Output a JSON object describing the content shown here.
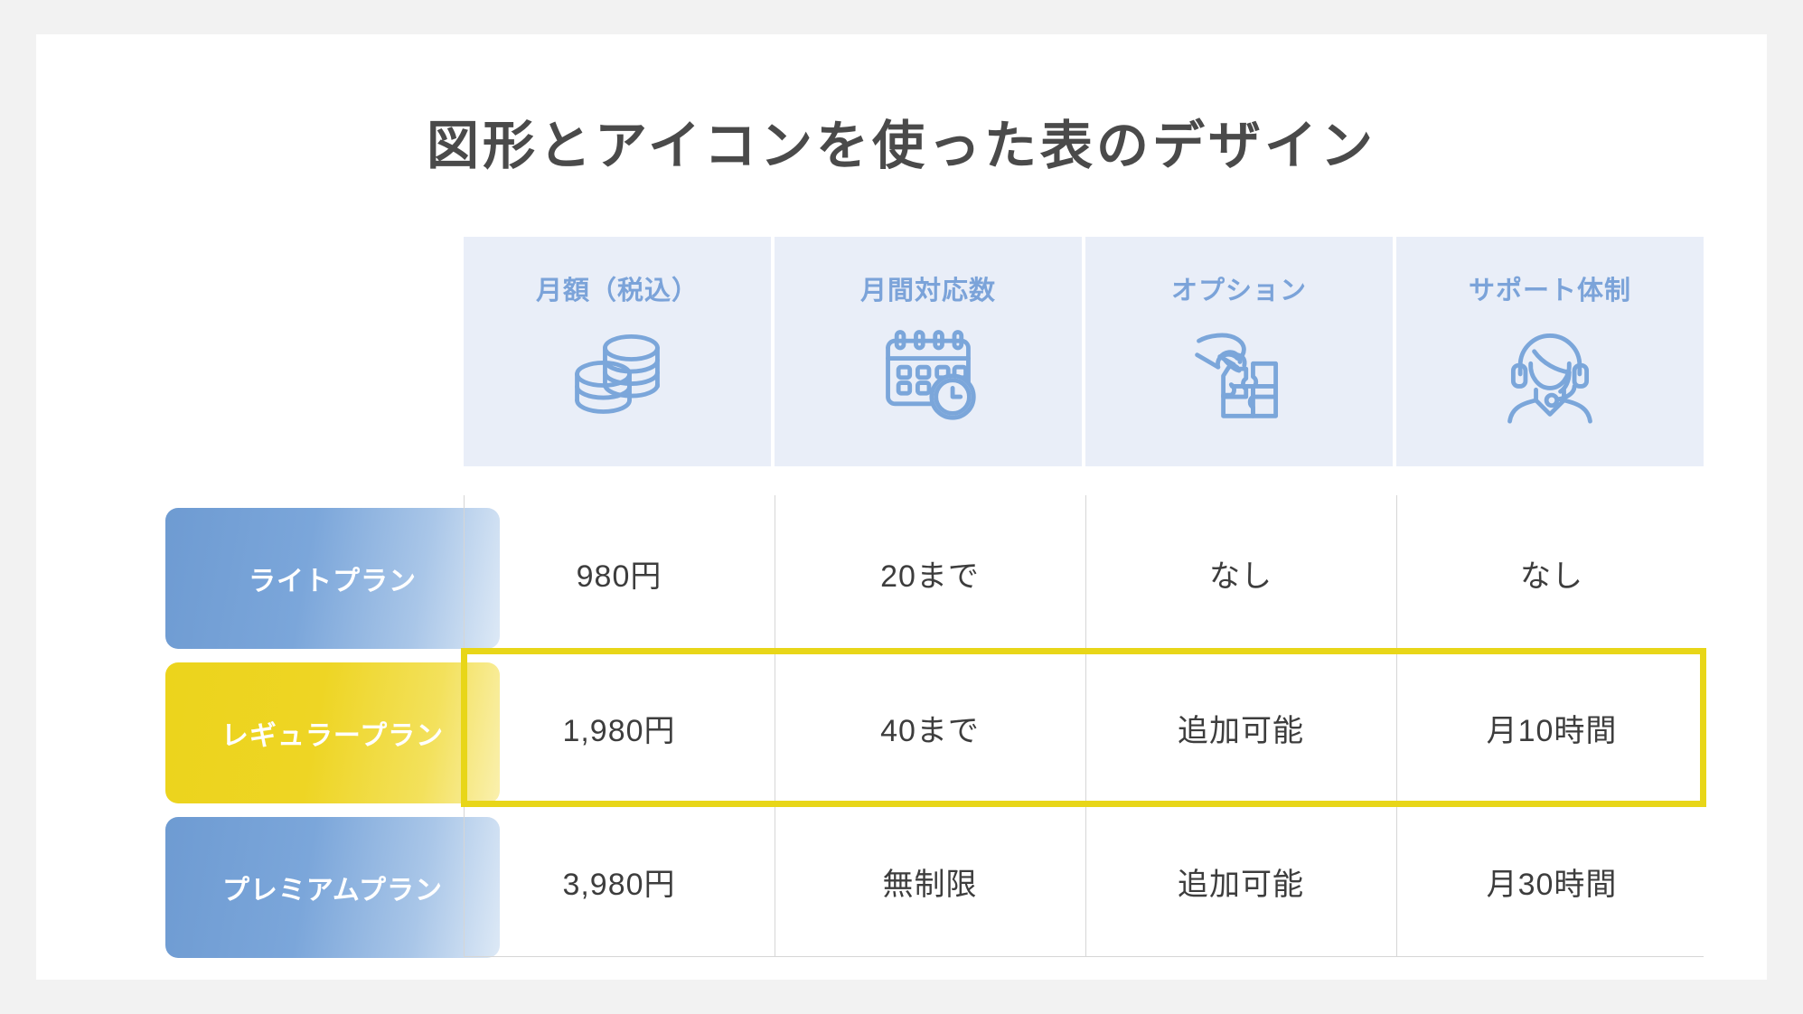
{
  "page": {
    "title": "図形とアイコンを使った表のデザイン",
    "background_color": "#f2f2f2",
    "card_color": "#ffffff"
  },
  "table": {
    "header_background": "#e9eef8",
    "header_text_color": "#7ba3d9",
    "highlight_color": "#e8d618",
    "columns": [
      {
        "label": "月額（税込）",
        "icon": "coins-icon"
      },
      {
        "label": "月間対応数",
        "icon": "calendar-clock-icon"
      },
      {
        "label": "オプション",
        "icon": "puzzle-hand-icon"
      },
      {
        "label": "サポート体制",
        "icon": "headset-support-icon"
      }
    ],
    "rows": [
      {
        "plan": "ライトプラン",
        "accent": "#7ba6da",
        "style": "blue",
        "highlighted": false,
        "cells": [
          "980円",
          "20まで",
          "なし",
          "なし"
        ]
      },
      {
        "plan": "レギュラープラン",
        "accent": "#edd51e",
        "style": "yellow",
        "highlighted": true,
        "cells": [
          "1,980円",
          "40まで",
          "追加可能",
          "月10時間"
        ]
      },
      {
        "plan": "プレミアムプラン",
        "accent": "#7ba6da",
        "style": "blue",
        "highlighted": false,
        "cells": [
          "3,980円",
          "無制限",
          "追加可能",
          "月30時間"
        ]
      }
    ]
  }
}
